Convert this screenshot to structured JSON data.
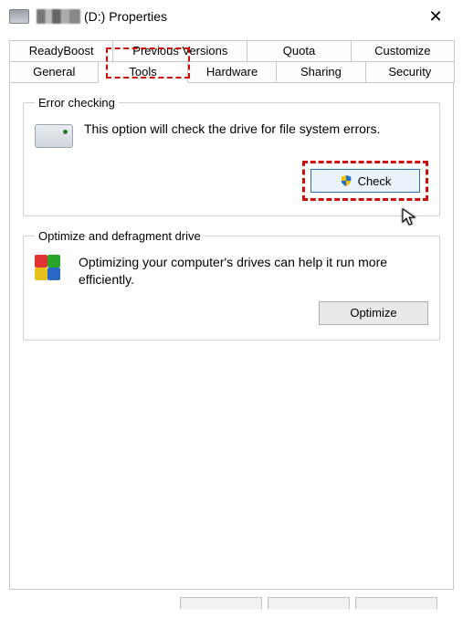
{
  "window": {
    "drive_label_obscured": "████",
    "title_suffix": "(D:) Properties",
    "close_glyph": "✕"
  },
  "tabs": {
    "row1": [
      {
        "label": "ReadyBoost"
      },
      {
        "label": "Previous Versions"
      },
      {
        "label": "Quota"
      },
      {
        "label": "Customize"
      }
    ],
    "row2": [
      {
        "label": "General"
      },
      {
        "label": "Tools",
        "active": true
      },
      {
        "label": "Hardware"
      },
      {
        "label": "Sharing"
      },
      {
        "label": "Security"
      }
    ]
  },
  "error_checking": {
    "legend": "Error checking",
    "description": "This option will check the drive for file system errors.",
    "button": "Check"
  },
  "defrag": {
    "legend": "Optimize and defragment drive",
    "description": "Optimizing your computer's drives can help it run more efficiently.",
    "button": "Optimize"
  }
}
